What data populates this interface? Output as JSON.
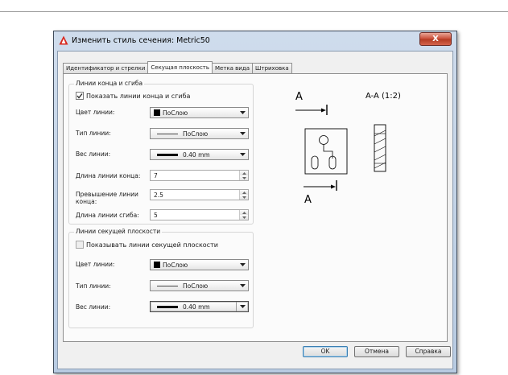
{
  "window": {
    "title": "Изменить стиль сечения: Metric50",
    "close_label": "X"
  },
  "tabs": [
    {
      "label": "Идентификатор и стрелки",
      "active": false
    },
    {
      "label": "Секущая плоскость",
      "active": true
    },
    {
      "label": "Метка вида",
      "active": false
    },
    {
      "label": "Штриховка",
      "active": false
    }
  ],
  "end_lines": {
    "title": "Линии конца и сгиба",
    "show_checkbox": {
      "label": "Показать линии конца и сгиба",
      "checked": true
    },
    "color": {
      "label": "Цвет линии:",
      "value": "ПоСлою"
    },
    "linetype": {
      "label": "Тип линии:",
      "value": "ПоСлою"
    },
    "weight": {
      "label": "Вес линии:",
      "value": "0.40 mm"
    },
    "end_length": {
      "label": "Длина линии конца:",
      "value": "7"
    },
    "overshoot": {
      "label": "Превышение линии конца:",
      "value": "2.5"
    },
    "bend_length": {
      "label": "Длина линии сгиба:",
      "value": "5"
    }
  },
  "plane_lines": {
    "title": "Линии секущей плоскости",
    "show_checkbox": {
      "label": "Показывать линии секущей плоскости",
      "checked": false
    },
    "color": {
      "label": "Цвет линии:",
      "value": "ПоСлою"
    },
    "linetype": {
      "label": "Тип линии:",
      "value": "ПоСлою"
    },
    "weight": {
      "label": "Вес линии:",
      "value": "0.40 mm"
    }
  },
  "preview": {
    "label_top": "A",
    "label_bottom": "A",
    "section_label": "A-A (1:2)"
  },
  "buttons": {
    "ok": "OK",
    "cancel": "Отмена",
    "help": "Справка"
  },
  "colors": {
    "accent_red": "#d8261c",
    "window_frame": "#b8cbe2"
  }
}
